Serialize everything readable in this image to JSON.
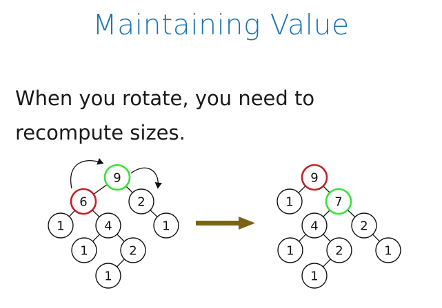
{
  "slide": {
    "title": "Maintaining Value",
    "body": "When you rotate, you need to recompute sizes."
  },
  "colors": {
    "title": "#1f74b0",
    "highlight_red": "#c0202a",
    "highlight_green": "#39e03a",
    "arrow": "#7a6315",
    "node_stroke": "#111111"
  },
  "trees": {
    "before": {
      "nodes": [
        {
          "id": "b9",
          "label": "9",
          "highlight": "green"
        },
        {
          "id": "b6",
          "label": "6",
          "highlight": "red"
        },
        {
          "id": "b2",
          "label": "2"
        },
        {
          "id": "b1a",
          "label": "1"
        },
        {
          "id": "b4",
          "label": "4"
        },
        {
          "id": "b1b",
          "label": "1"
        },
        {
          "id": "b1c",
          "label": "1"
        },
        {
          "id": "b2b",
          "label": "2"
        },
        {
          "id": "b1d",
          "label": "1"
        }
      ],
      "edges": [
        [
          "b9",
          "b6"
        ],
        [
          "b9",
          "b2"
        ],
        [
          "b6",
          "b1a"
        ],
        [
          "b6",
          "b4"
        ],
        [
          "b2",
          "b1b"
        ],
        [
          "b4",
          "b1c"
        ],
        [
          "b4",
          "b2b"
        ],
        [
          "b2b",
          "b1d"
        ]
      ]
    },
    "after": {
      "nodes": [
        {
          "id": "a9",
          "label": "9",
          "highlight": "red"
        },
        {
          "id": "a1a",
          "label": "1"
        },
        {
          "id": "a7",
          "label": "7",
          "highlight": "green"
        },
        {
          "id": "a4",
          "label": "4"
        },
        {
          "id": "a2",
          "label": "2"
        },
        {
          "id": "a1b",
          "label": "1"
        },
        {
          "id": "a2b",
          "label": "2"
        },
        {
          "id": "a1c",
          "label": "1"
        },
        {
          "id": "a1d",
          "label": "1"
        }
      ],
      "edges": [
        [
          "a9",
          "a1a"
        ],
        [
          "a9",
          "a7"
        ],
        [
          "a7",
          "a4"
        ],
        [
          "a7",
          "a2"
        ],
        [
          "a4",
          "a1b"
        ],
        [
          "a4",
          "a2b"
        ],
        [
          "a2",
          "a1c"
        ],
        [
          "a2b",
          "a1d"
        ]
      ]
    }
  }
}
